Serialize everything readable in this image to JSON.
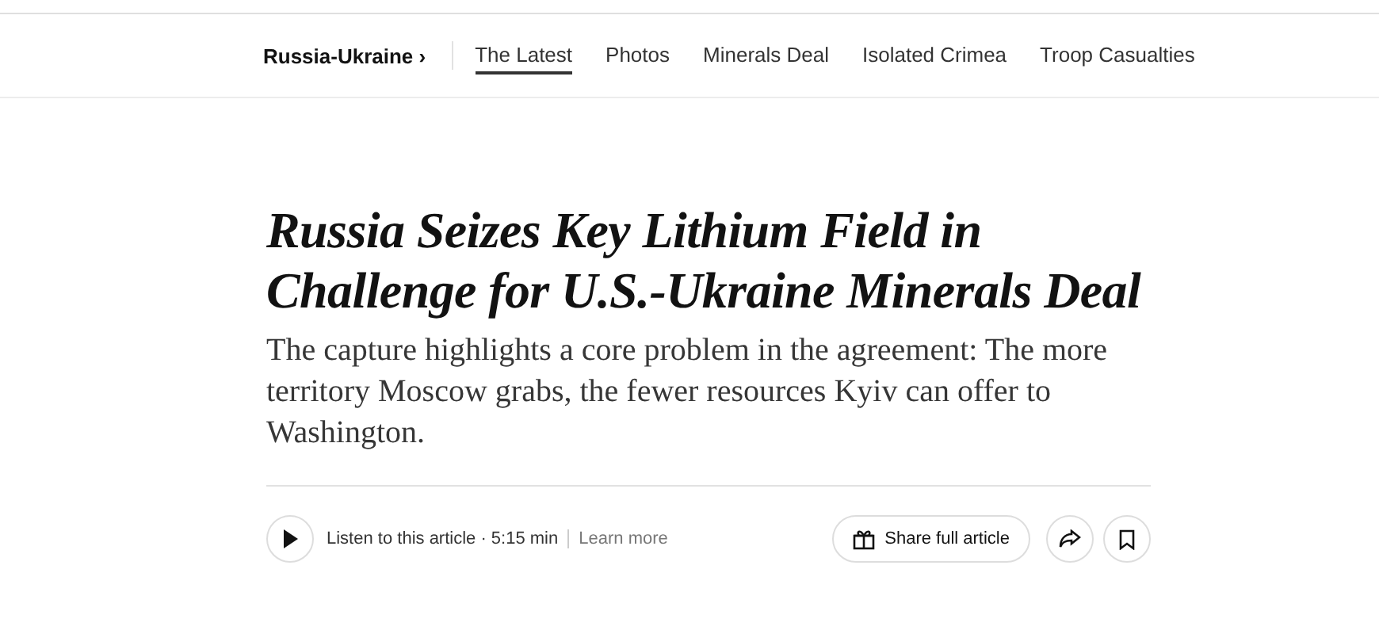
{
  "nav": {
    "section": "Russia-Ukraine ›",
    "tabs": [
      {
        "label": "The Latest",
        "selected": true
      },
      {
        "label": "Photos",
        "selected": false
      },
      {
        "label": "Minerals Deal",
        "selected": false
      },
      {
        "label": "Isolated Crimea",
        "selected": false
      },
      {
        "label": "Troop Casualties",
        "selected": false
      }
    ]
  },
  "headline": "Russia Seizes Key Lithium Field in Challenge for U.S.-Ukraine Minerals Deal",
  "summary": "The capture highlights a core problem in the agreement: The more territory Moscow grabs, the fewer resources Kyiv can offer to Washington.",
  "toolbar": {
    "listen": "Listen to this article · 5:15 min",
    "learn_more": "Learn more",
    "share": "Share full article"
  }
}
